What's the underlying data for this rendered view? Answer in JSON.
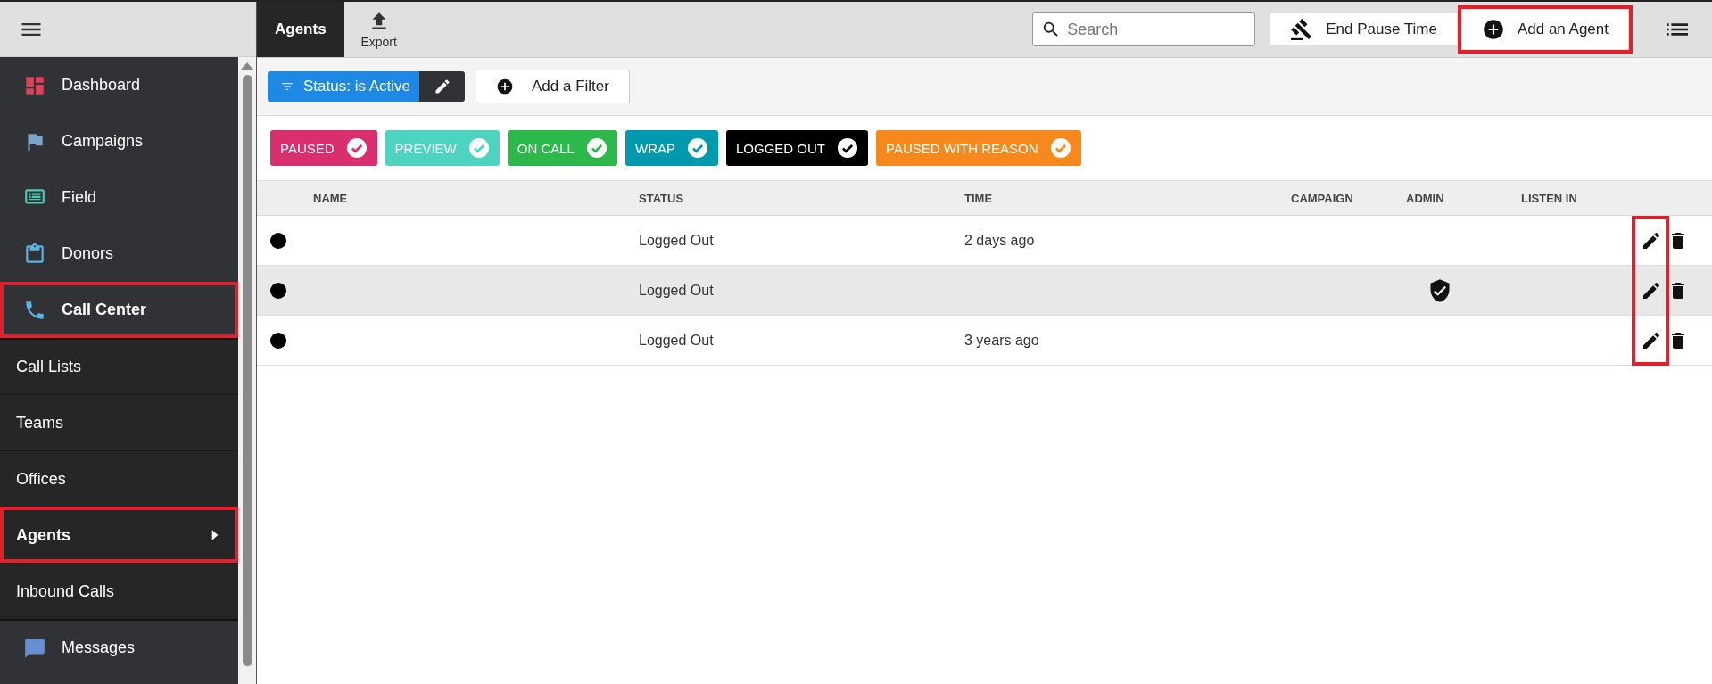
{
  "sidebar": {
    "items": [
      {
        "label": "Dashboard",
        "kind": "section",
        "selected": false,
        "annotated": false
      },
      {
        "label": "Campaigns",
        "kind": "section",
        "selected": false,
        "annotated": false
      },
      {
        "label": "Field",
        "kind": "section",
        "selected": false,
        "annotated": false
      },
      {
        "label": "Donors",
        "kind": "section",
        "selected": false,
        "annotated": false
      },
      {
        "label": "Call Center",
        "kind": "section",
        "selected": true,
        "annotated": true
      },
      {
        "label": "Call Lists",
        "kind": "subitem",
        "selected": false,
        "annotated": false
      },
      {
        "label": "Teams",
        "kind": "subitem",
        "selected": false,
        "annotated": false
      },
      {
        "label": "Offices",
        "kind": "subitem",
        "selected": false,
        "annotated": false
      },
      {
        "label": "Agents",
        "kind": "subitem",
        "selected": true,
        "annotated": true
      },
      {
        "label": "Inbound Calls",
        "kind": "subitem",
        "selected": false,
        "annotated": false
      },
      {
        "label": "Messages",
        "kind": "section",
        "selected": false,
        "annotated": false
      }
    ]
  },
  "toolbar": {
    "tabs": [
      {
        "label": "Agents",
        "selected": true
      }
    ],
    "export": "Export",
    "search": {
      "placeholder": "Search"
    },
    "buttons": [
      {
        "label": "End Pause Time",
        "annotated": false
      },
      {
        "label": "Add an Agent",
        "annotated": true
      }
    ]
  },
  "filters": {
    "active": [
      {
        "label": "Status: is Active"
      }
    ],
    "add_filter": "Add a Filter"
  },
  "status_tags": [
    {
      "label": "PAUSED",
      "color": "#d92f6f",
      "checked": true
    },
    {
      "label": "PREVIEW",
      "color": "#4dd4c0",
      "checked": true
    },
    {
      "label": "ON CALL",
      "color": "#2db84b",
      "checked": true
    },
    {
      "label": "WRAP",
      "color": "#0099ad",
      "checked": true
    },
    {
      "label": "LOGGED OUT",
      "color": "#000000",
      "checked": true
    },
    {
      "label": "PAUSED WITH REASON",
      "color": "#f7891c",
      "checked": true
    }
  ],
  "table": {
    "columns": [
      "NAME",
      "STATUS",
      "TIME",
      "CAMPAIGN",
      "ADMIN",
      "LISTEN IN"
    ],
    "rows": [
      {
        "status": "Logged Out",
        "time": "2 days ago",
        "admin": false
      },
      {
        "status": "Logged Out",
        "time": "",
        "admin": true
      },
      {
        "status": "Logged Out",
        "time": "3 years ago",
        "admin": false
      }
    ],
    "edit_annotated": true
  }
}
